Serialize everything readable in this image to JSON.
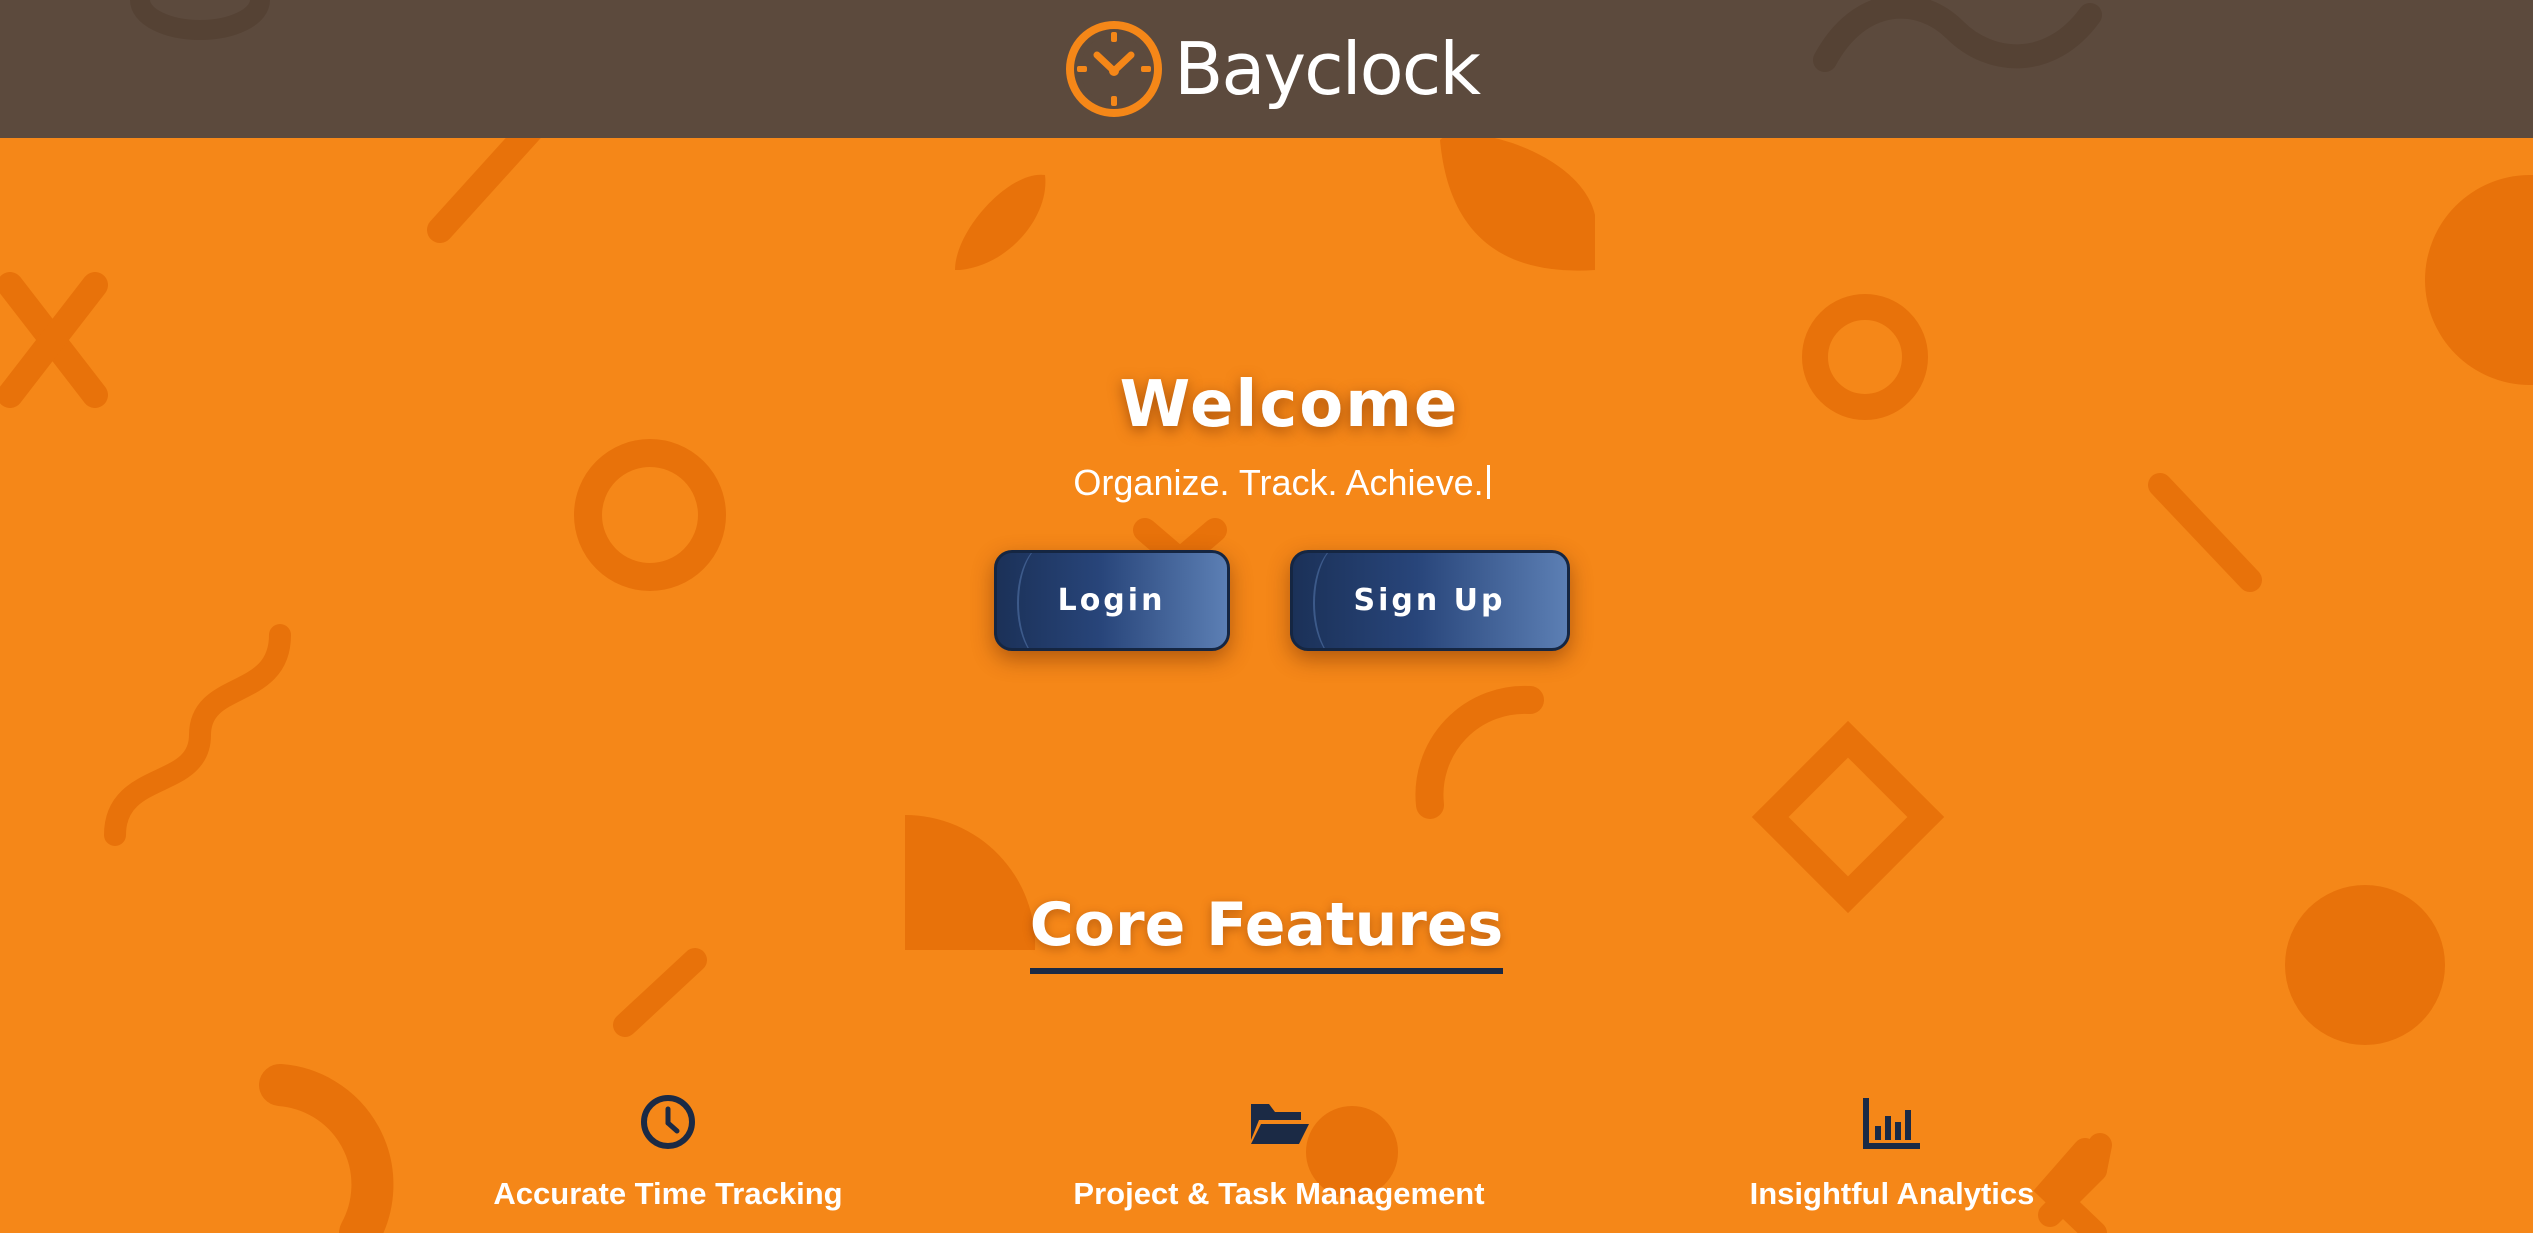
{
  "header": {
    "brand_name": "Bayclock",
    "logo_icon": "clock-icon",
    "background_color": "#5c4a3d",
    "logo_color": "#f58718"
  },
  "hero": {
    "title": "Welcome",
    "subtitle": "Organize. Track. Achieve.",
    "buttons": {
      "login_label": "Login",
      "signup_label": "Sign Up"
    }
  },
  "features": {
    "section_title": "Core Features",
    "items": [
      {
        "label": "Accurate Time Tracking",
        "icon": "clock-icon"
      },
      {
        "label": "Project & Task Management",
        "icon": "folder-open-icon"
      },
      {
        "label": "Insightful Analytics",
        "icon": "bar-chart-icon"
      }
    ]
  },
  "colors": {
    "page_background": "#f58718",
    "decor_shapes": "#e8720a",
    "button_dark": "#1b3158",
    "button_light": "#5c7fb4",
    "text": "#ffffff",
    "icon_navy": "#1b2a45"
  }
}
